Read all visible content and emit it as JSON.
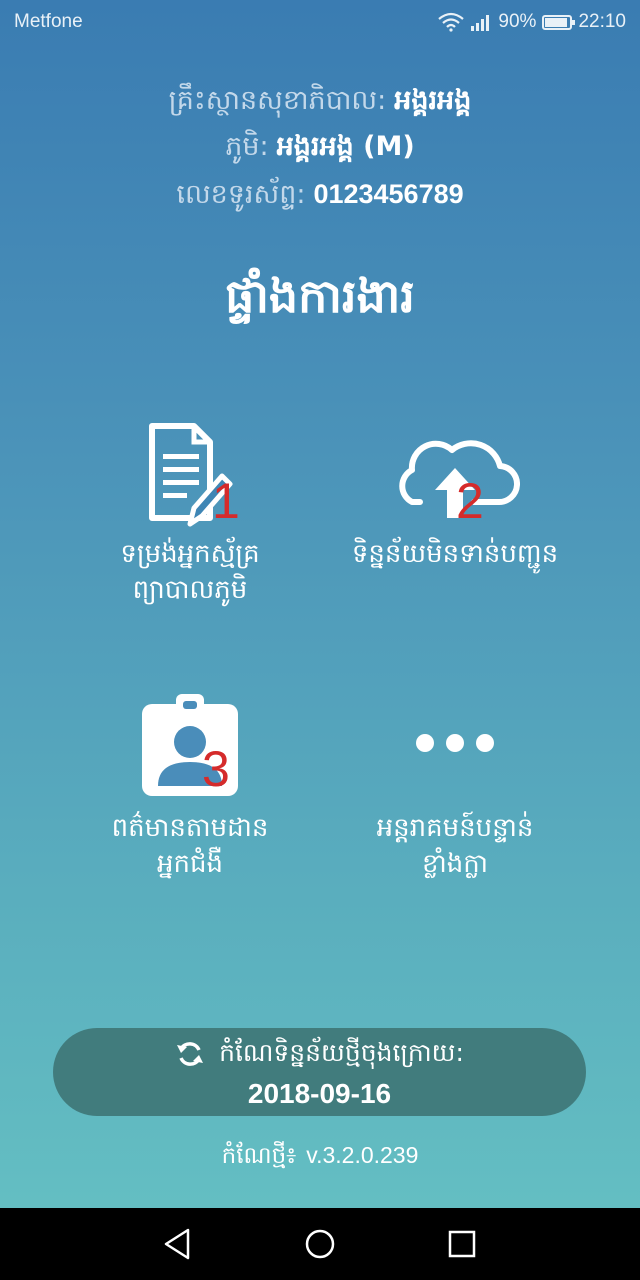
{
  "status_bar": {
    "carrier": "Metfone",
    "battery": "90%",
    "battery_level": 0.9,
    "time": "22:10"
  },
  "header": {
    "facility_label": "គ្រឹះស្ថានសុខាភិបាល:",
    "facility_value": "អង្គរអង្គ",
    "village_label": "ភូមិ:",
    "village_value": "អង្គរអង្គ (M)",
    "phone_label": "លេខទូរស័ព្ទ:",
    "phone_value": "0123456789"
  },
  "title": "ផ្ទាំងការងារ",
  "menu": [
    {
      "number": "1",
      "label_line1": "ទម្រង់អ្នកស្ម័គ្រ",
      "label_line2": "ព្យាបាលភូមិ",
      "icon": "document-edit-icon"
    },
    {
      "number": "2",
      "label_line1": "ទិន្នន័យមិនទាន់បញ្ជូន",
      "label_line2": "",
      "icon": "cloud-upload-icon"
    },
    {
      "number": "3",
      "label_line1": "ពត៌មានតាមដាន",
      "label_line2": "អ្នកជំងឺ",
      "icon": "patient-badge-icon"
    },
    {
      "number": "",
      "label_line1": "អន្តរាគមន៍បន្ទាន់",
      "label_line2": "ខ្លាំងក្លា",
      "icon": "more-dots-icon"
    }
  ],
  "sync": {
    "label": "កំណែទិន្នន័យថ្មីចុងក្រោយ:",
    "date": "2018-09-16",
    "icon": "refresh-icon"
  },
  "version": {
    "label": "កំណែថ្មី៖",
    "value": "v.3.2.0.239"
  },
  "colors": {
    "gradient_top": "#3a7cb2",
    "gradient_bottom": "#66c2c3",
    "badge_red": "#d52b2b",
    "sync_pill": "#417c7d"
  }
}
